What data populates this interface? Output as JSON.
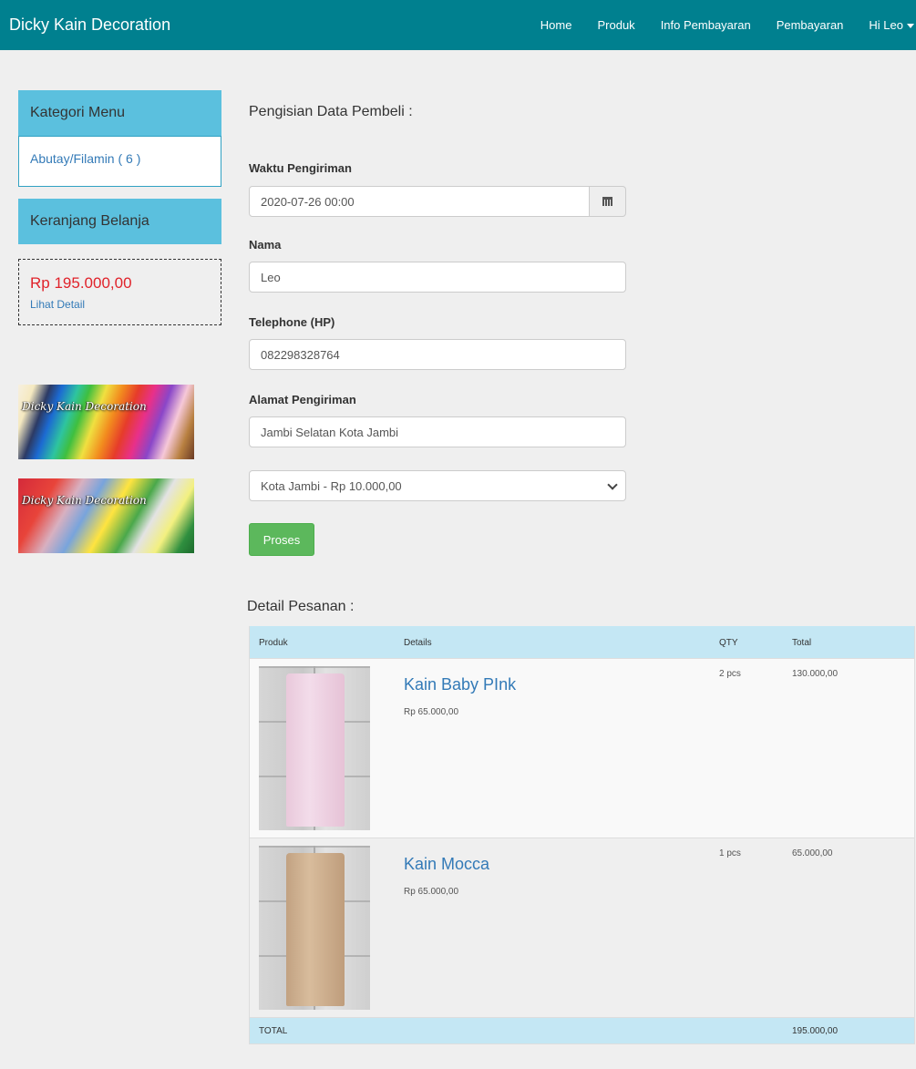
{
  "navbar": {
    "brand": "Dicky Kain Decoration",
    "items": [
      "Home",
      "Produk",
      "Info Pembayaran",
      "Pembayaran"
    ],
    "user_menu": "Hi Leo"
  },
  "sidebar": {
    "kategori_title": "Kategori Menu",
    "kategori_item": "Abutay/Filamin ( 6 )",
    "keranjang_title": "Keranjang Belanja",
    "cart_total": "Rp 195.000,00",
    "cart_link": "Lihat Detail",
    "banners": [
      "Dicky Kain Decoration",
      "Dicky Kain Decoration"
    ]
  },
  "form": {
    "title": "Pengisian Data Pembeli :",
    "waktu_label": "Waktu Pengiriman",
    "waktu_value": "2020-07-26 00:00",
    "nama_label": "Nama",
    "nama_value": "Leo",
    "telp_label": "Telephone (HP)",
    "telp_value": "082298328764",
    "alamat_label": "Alamat Pengiriman",
    "alamat_value": "Jambi Selatan Kota Jambi",
    "ongkir_selected": "Kota Jambi - Rp 10.000,00",
    "submit_label": "Proses"
  },
  "order": {
    "title": "Detail Pesanan :",
    "headers": [
      "Produk",
      "Details",
      "QTY",
      "Total"
    ],
    "items": [
      {
        "name": "Kain Baby PInk",
        "price": "Rp 65.000,00",
        "qty": "2 pcs",
        "total": "130.000,00"
      },
      {
        "name": "Kain Mocca",
        "price": "Rp 65.000,00",
        "qty": "1 pcs",
        "total": "65.000,00"
      }
    ],
    "footer_label": "TOTAL",
    "footer_total": "195.000,00"
  },
  "colors": {
    "navbar": "#00808f",
    "sidebar_header": "#5bc0de",
    "cart_total": "#e0222a",
    "link": "#337ab7",
    "button": "#5cb85c",
    "table_header": "#c4e7f4"
  }
}
